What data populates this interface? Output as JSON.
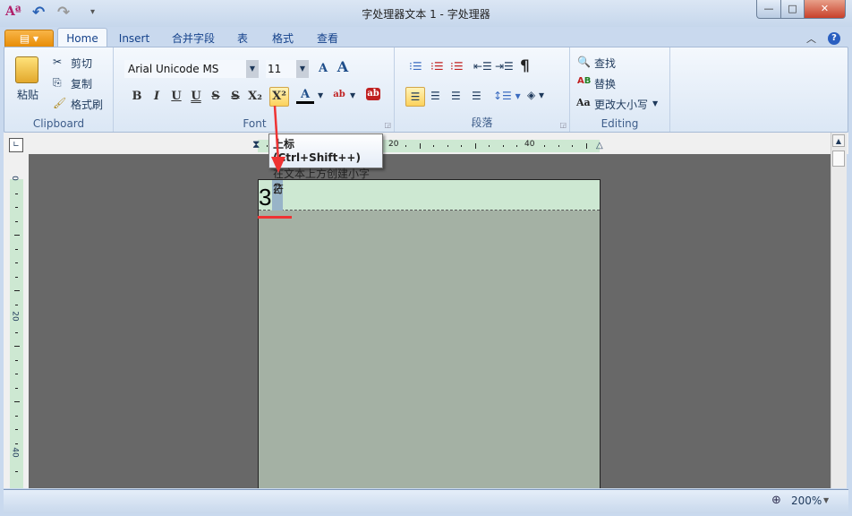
{
  "window": {
    "title": "字处理器文本 1 - 字处理器",
    "minimize": "—",
    "maximize": "□",
    "close": "✕"
  },
  "qat": {
    "app_icon": "Aª",
    "undo": "↶",
    "redo": "↷",
    "more": "▾"
  },
  "tabs": [
    {
      "label": "Home"
    },
    {
      "label": "Insert"
    },
    {
      "label": "合并字段"
    },
    {
      "label": "表"
    },
    {
      "label": "格式"
    },
    {
      "label": "查看"
    }
  ],
  "file_tab": "▤ ▾",
  "help": {
    "collapse": "︿",
    "help": "?"
  },
  "clipboard": {
    "label": "Clipboard",
    "paste": "粘贴",
    "cut": "剪切",
    "copy": "复制",
    "format_painter": "格式刷"
  },
  "font": {
    "label": "Font",
    "family": "Arial Unicode MS",
    "size": "11",
    "grow": "A",
    "shrink": "A",
    "buttons": [
      "B",
      "I",
      "U",
      "U",
      "S",
      "S",
      "X₂",
      "X²"
    ],
    "font_color": "A",
    "highlight": "ab",
    "clear": "ab"
  },
  "paragraph": {
    "label": "段落",
    "pilcrow": "¶"
  },
  "editing": {
    "label": "Editing",
    "find": "查找",
    "replace": "替换",
    "change_case": "更改大小写",
    "case_icon": "Aa"
  },
  "ruler": {
    "h_labels": [
      "20",
      "40"
    ],
    "v_labels": [
      "0",
      "20",
      "40"
    ]
  },
  "document": {
    "base": "3",
    "superscript": "2"
  },
  "tooltip": {
    "title": "上标 (Ctrl+Shift++)",
    "description": "在文本上方创建小字符"
  },
  "status": {
    "zoom": "200%"
  },
  "colors": {
    "accent": "#fcd25c",
    "annotation": "#ee3333",
    "header_bg": "#cde8d2"
  }
}
